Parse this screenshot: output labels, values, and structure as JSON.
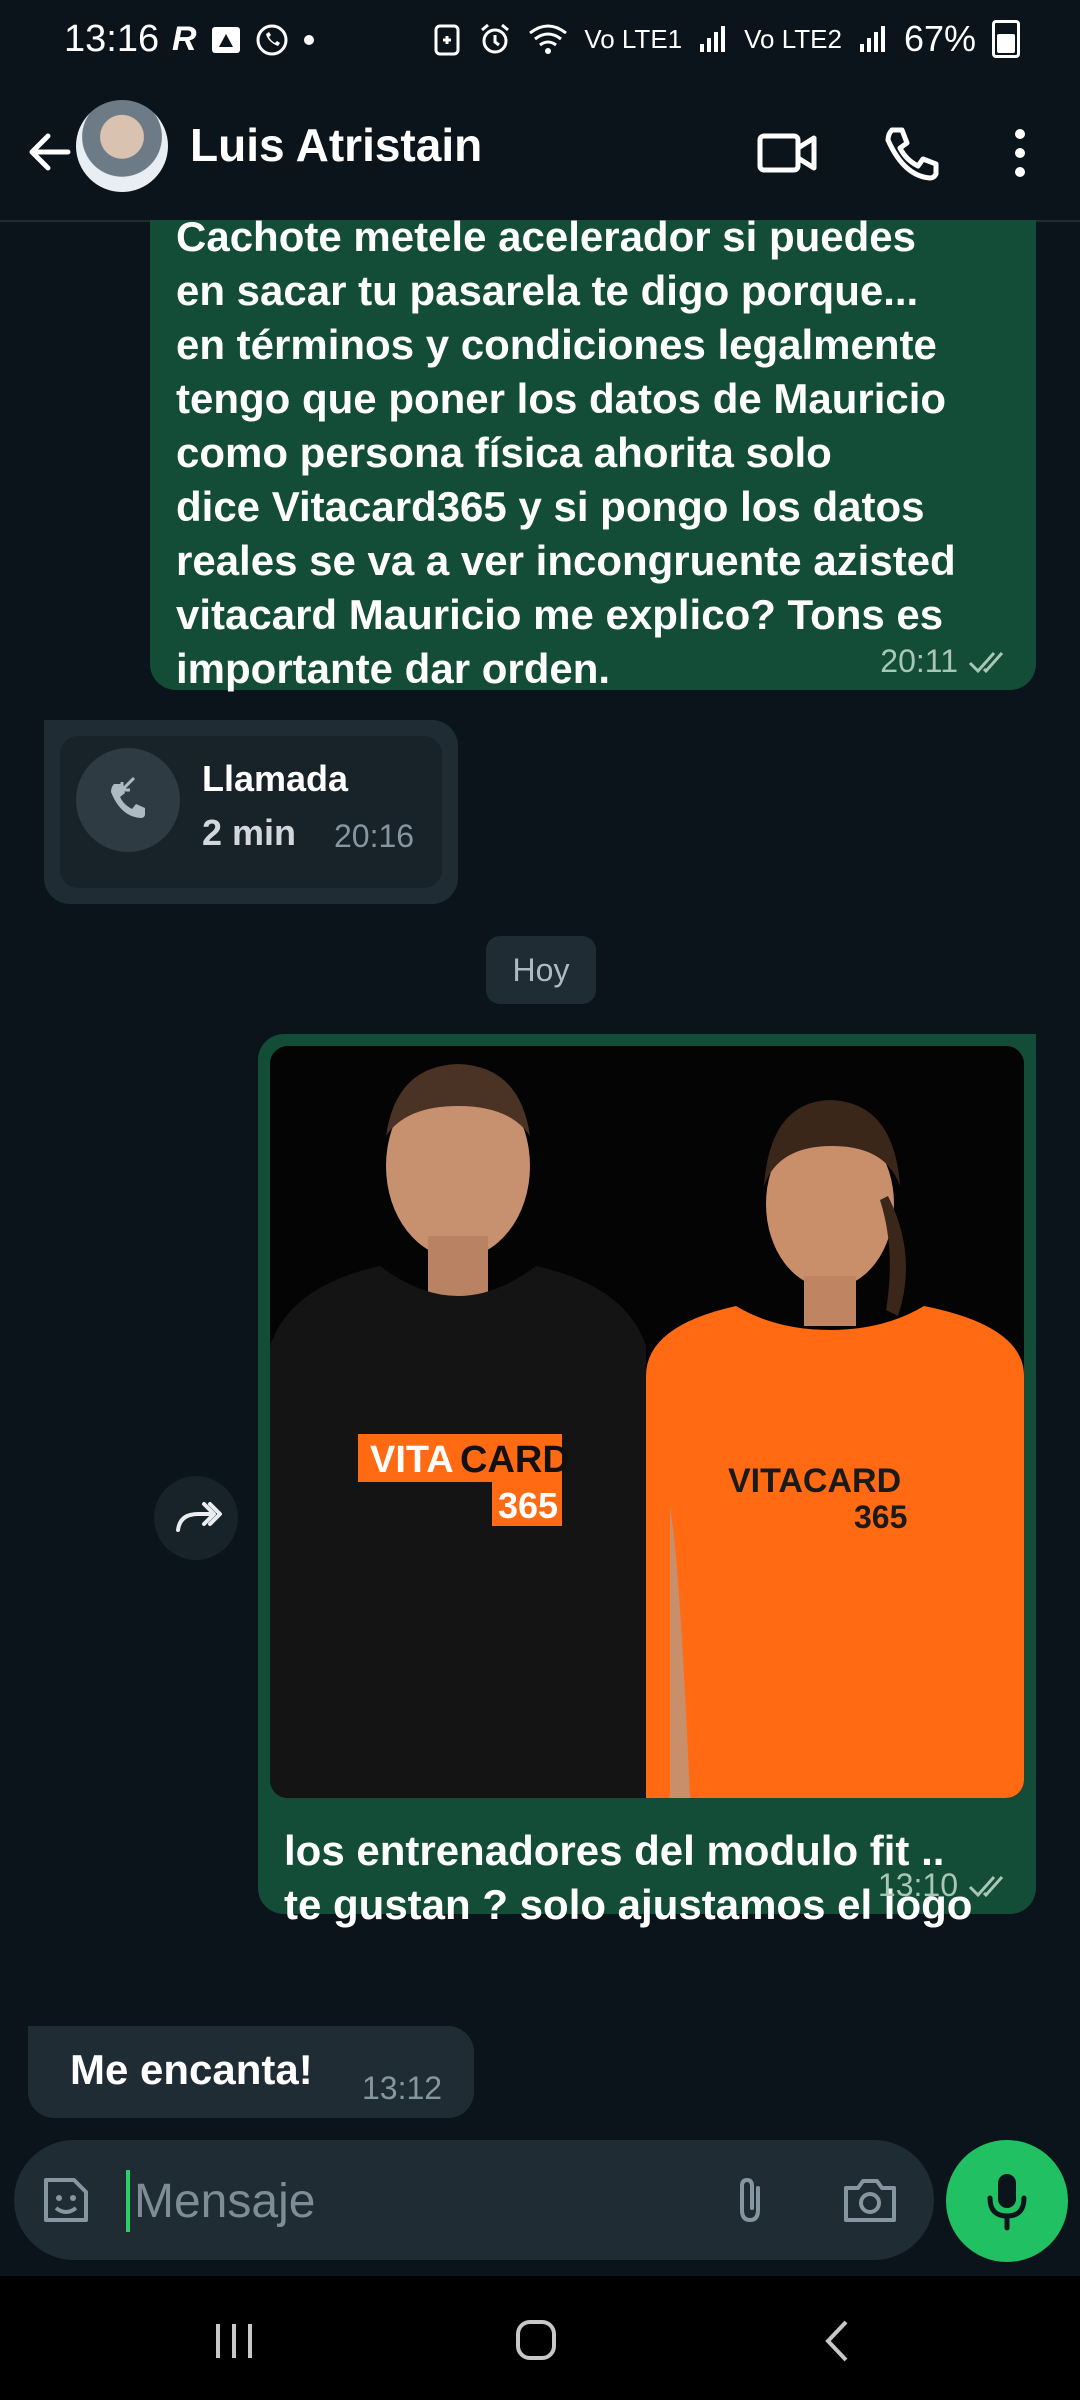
{
  "status_bar": {
    "time": "13:16",
    "battery": "67%",
    "network1": "Vo LTE1",
    "network2": "Vo LTE2"
  },
  "header": {
    "contact_name": "Luis Atristain"
  },
  "messages": {
    "outgoing_text": {
      "lines": [
        "Cachote metele acelerador si puedes",
        "en sacar tu pasarela te digo porque...",
        "en términos y condiciones legalmente",
        "tengo que poner los datos de Mauricio",
        "como persona física ahorita solo",
        "dice Vitacard365 y si pongo los datos",
        "reales se va a ver incongruente azisted",
        "vitacard Mauricio me explico? Tons es",
        "importante dar orden."
      ],
      "time": "20:11"
    },
    "call": {
      "title": "Llamada",
      "duration": "2 min",
      "time": "20:16"
    },
    "day_separator": "Hoy",
    "image_message": {
      "shirt_text_left": "VITA",
      "shirt_text_left_accent": "CARD",
      "shirt_number_left": "365",
      "shirt_text_right": "VITACARD",
      "shirt_number_right": "365",
      "caption_line1": "los entrenadores del modulo fit ..",
      "caption_line2": "te gustan ? solo ajustamos el logo",
      "time": "13:10"
    },
    "incoming": {
      "text": "Me encanta!",
      "time": "13:12"
    }
  },
  "input": {
    "placeholder": "Mensaje"
  },
  "colors": {
    "outgoing_bubble": "#134d37",
    "incoming_bubble": "#1f2c33",
    "background": "#0b141a",
    "accent_green": "#21c063",
    "shirt_orange": "#ff6a13"
  }
}
